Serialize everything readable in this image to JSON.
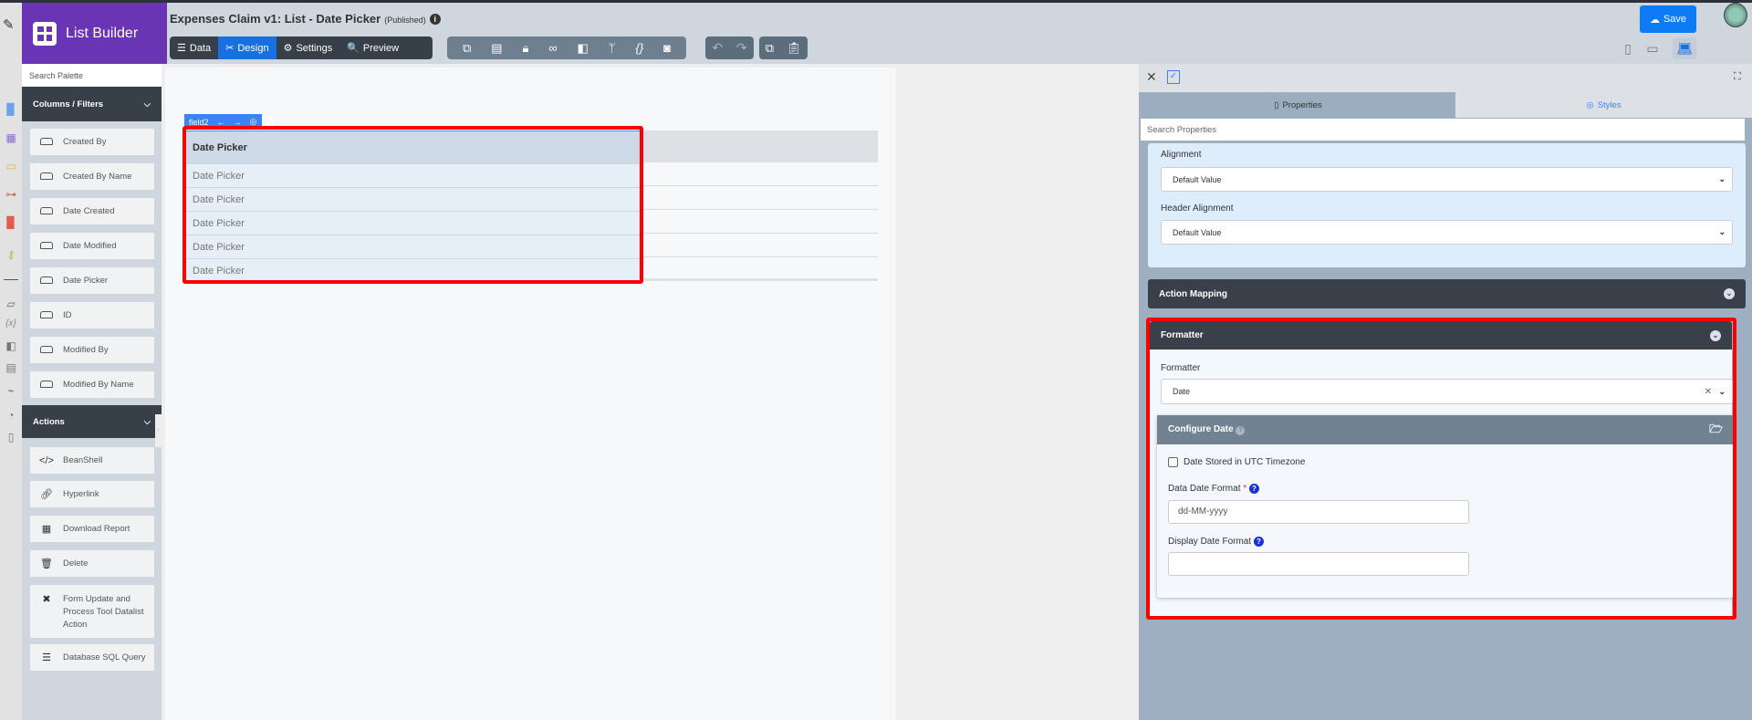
{
  "app": {
    "brand": "List Builder"
  },
  "header": {
    "title": "Expenses Claim v1: List - Date Picker",
    "status": "(Published)",
    "save_label": "Save",
    "tabs": [
      {
        "label": "Data",
        "icon": "table-icon"
      },
      {
        "label": "Design",
        "icon": "design-tools-icon",
        "active": true
      },
      {
        "label": "Settings",
        "icon": "gear-icon"
      },
      {
        "label": "Preview",
        "icon": "preview-icon"
      }
    ]
  },
  "palette": {
    "search_placeholder": "Search Palette",
    "columns_header": "Columns / Filters",
    "columns": [
      "Created By",
      "Created By Name",
      "Date Created",
      "Date Modified",
      "Date Picker",
      "ID",
      "Modified By",
      "Modified By Name"
    ],
    "actions_header": "Actions",
    "actions": [
      {
        "label": "BeanShell",
        "icon": "code-icon"
      },
      {
        "label": "Hyperlink",
        "icon": "link-icon"
      },
      {
        "label": "Download Report",
        "icon": "grid-icon"
      },
      {
        "label": "Delete",
        "icon": "trash-icon"
      },
      {
        "label": "Form Update and Process Tool Datalist Action",
        "icon": "tools-icon"
      },
      {
        "label": "Database SQL Query",
        "icon": "database-icon"
      }
    ]
  },
  "canvas": {
    "field_label": "field2",
    "column_header": "Date Picker",
    "rows": [
      "Date Picker",
      "Date Picker",
      "Date Picker",
      "Date Picker",
      "Date Picker"
    ]
  },
  "properties": {
    "tab_properties": "Properties",
    "tab_styles": "Styles",
    "search_placeholder": "Search Properties",
    "alignment_label": "Alignment",
    "alignment_value": "Default Value",
    "header_alignment_label": "Header Alignment",
    "header_alignment_value": "Default Value",
    "action_mapping": "Action Mapping",
    "formatter_section": "Formatter",
    "formatter_label": "Formatter",
    "formatter_value": "Date",
    "configure_title": "Configure Date",
    "utc_label": "Date Stored in UTC Timezone",
    "utc_checked": false,
    "data_format_label": "Data Date Format",
    "required_mark": "*",
    "data_format_value": "dd-MM-yyyy",
    "display_format_label": "Display Date Format",
    "display_format_value": ""
  },
  "colors": {
    "brand": "#6a35b5",
    "accent": "#1670e0",
    "highlight": "#ff0000"
  }
}
